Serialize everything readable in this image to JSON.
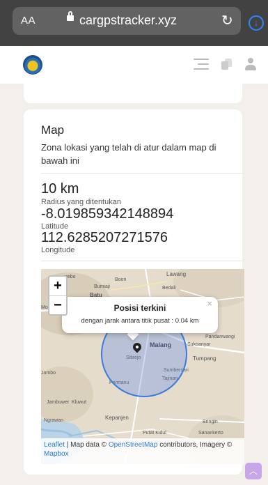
{
  "browser": {
    "text_size_label": "AA",
    "url": "cargpstracker.xyz",
    "reload_icon": "reload-icon",
    "download_icon": "download-icon"
  },
  "header": {
    "logo_icon": "institution-logo",
    "icons": [
      "menu-icon",
      "copy-icon",
      "user-icon"
    ]
  },
  "map_card": {
    "title": "Map",
    "description": "Zona lokasi yang telah di atur dalam map di bawah ini",
    "radius_value": "10 km",
    "radius_label": "Radius yang ditentukan",
    "latitude_value": "-8.019859342148894",
    "latitude_label": "Latitude",
    "longitude_value": "112.6285207271576",
    "longitude_label": "Longitude"
  },
  "map": {
    "zoom_in": "+",
    "zoom_out": "−",
    "popup_title": "Posisi terkini",
    "popup_text": "dengan jarak antara titik pusat : 0.04 km",
    "popup_close": "×",
    "labels": {
      "boon": "Boon",
      "lawang": "Lawang",
      "bumiaji": "Bumiaji",
      "bedali": "Bedali",
      "batu": "Batu",
      "malang": "Malang",
      "pandanwangi": "Pandanwangi",
      "sitirejo": "Sitirejo",
      "sukoanyar": "Sukoanyar",
      "tumpang": "Tumpang",
      "sumbersari": "Sumbersari",
      "tajinan": "Tajinan",
      "permanu": "Permanu",
      "jambuwer": "Jambuwer",
      "kluwut": "Kluwut",
      "kepanjen": "Kepanjen",
      "bringin": "Bringin",
      "ngrawan": "Ngrawan",
      "putat_kidul": "Putat Kidul",
      "sanankerto": "Sanankerto",
      "mojorejo": "Mojorejo",
      "jombo": "Jombo",
      "ngebo": "ngebo"
    },
    "attribution": {
      "leaflet": "Leaflet",
      "sep": " | Map data © ",
      "osm": "OpenStreetMap",
      "rest": " contributors, Imagery © ",
      "mapbox": "Mapbox"
    }
  },
  "scroll_top_icon": "chevron-up-icon"
}
